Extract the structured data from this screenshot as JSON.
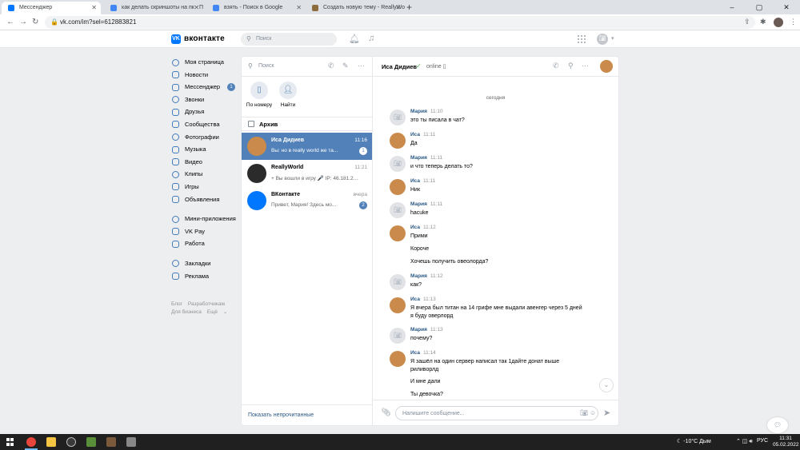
{
  "browser": {
    "tabs": [
      {
        "title": "Мессенджер",
        "active": true,
        "favicon_color": "#0077ff"
      },
      {
        "title": "как делать скриншоты на пк - П",
        "active": false,
        "favicon_color": "#4285f4"
      },
      {
        "title": "взять - Поиск в Google",
        "active": false,
        "favicon_color": "#4285f4"
      },
      {
        "title": "Создать новую тему - ReallyWo",
        "active": false,
        "favicon_color": "#8a6d3b"
      }
    ],
    "url": "vk.com/im?sel=612883821"
  },
  "vk_header": {
    "logo": "VK",
    "brand": "вконтакте",
    "search_placeholder": "Поиск"
  },
  "left_nav": {
    "items": [
      {
        "label": "Моя страница",
        "icon": "user-icon"
      },
      {
        "label": "Новости",
        "icon": "news-icon"
      },
      {
        "label": "Мессенджер",
        "icon": "message-icon",
        "badge": "1"
      },
      {
        "label": "Звонки",
        "icon": "phone-icon"
      },
      {
        "label": "Друзья",
        "icon": "friends-icon"
      },
      {
        "label": "Сообщества",
        "icon": "communities-icon"
      },
      {
        "label": "Фотографии",
        "icon": "photo-icon"
      },
      {
        "label": "Музыка",
        "icon": "music-icon"
      },
      {
        "label": "Видео",
        "icon": "video-icon"
      },
      {
        "label": "Клипы",
        "icon": "clips-icon"
      },
      {
        "label": "Игры",
        "icon": "games-icon"
      },
      {
        "label": "Объявления",
        "icon": "ads-icon"
      }
    ],
    "items2": [
      {
        "label": "Мини-приложения",
        "icon": "apps-icon"
      },
      {
        "label": "VK Pay",
        "icon": "vkpay-icon"
      },
      {
        "label": "Работа",
        "icon": "work-icon"
      }
    ],
    "items3": [
      {
        "label": "Закладки",
        "icon": "bookmark-icon"
      },
      {
        "label": "Реклама",
        "icon": "advertising-icon"
      }
    ],
    "footer": {
      "blog": "Блог",
      "developers": "Разработчикам",
      "business": "Для бизнеса",
      "more": "Ещё"
    }
  },
  "conversations": {
    "search_placeholder": "Поиск",
    "quick_actions": [
      {
        "label": "По номеру"
      },
      {
        "label": "Найти"
      }
    ],
    "archive_label": "Архив",
    "list": [
      {
        "name": "Иса Дидиев",
        "time": "11:16",
        "preview": "Вы: но в really world же та...",
        "badge": "1",
        "active": true,
        "avatar_color": "#c98a4b"
      },
      {
        "name": "ReallyWorld",
        "time": "11:21",
        "preview": "+ Вы вошли в игру 🎤 IP: 46.181.21...",
        "badge": "",
        "active": false,
        "avatar_color": "#2b2b2b"
      },
      {
        "name": "ВКонтакте",
        "time": "вчера",
        "preview": "Привет, Мария! Здесь мо...",
        "badge": "2",
        "active": false,
        "avatar_color": "#0077ff"
      }
    ],
    "footer_link": "Показать непрочитанные"
  },
  "chat": {
    "peer_name": "Иса Дидиев",
    "peer_status": "online",
    "day_label": "сегодня",
    "composer_placeholder": "Напишите сообщение...",
    "messages": [
      {
        "author": "Мария",
        "time": "11:10",
        "lines": [
          "это ты писала в чат?"
        ],
        "avatar": "camera"
      },
      {
        "author": "Иса",
        "time": "11:11",
        "lines": [
          "Да"
        ],
        "avatar": "photo"
      },
      {
        "author": "Мария",
        "time": "11:11",
        "lines": [
          "и что теперь делать то?"
        ],
        "avatar": "camera"
      },
      {
        "author": "Иса",
        "time": "11:11",
        "lines": [
          "Ник"
        ],
        "avatar": "photo"
      },
      {
        "author": "Мария",
        "time": "11:11",
        "lines": [
          "hacuke"
        ],
        "avatar": "camera"
      },
      {
        "author": "Иса",
        "time": "11:12",
        "lines": [
          "Прими",
          "Короче",
          "Хочешь получить овеолорда?"
        ],
        "avatar": "photo"
      },
      {
        "author": "Мария",
        "time": "11:12",
        "lines": [
          "как?"
        ],
        "avatar": "camera"
      },
      {
        "author": "Иса",
        "time": "11:13",
        "lines": [
          "Я вчера был титан на 14 грифе мне выдали авенгер через 5 дней я буду оверлорд"
        ],
        "avatar": "photo"
      },
      {
        "author": "Мария",
        "time": "11:13",
        "lines": [
          "почему?"
        ],
        "avatar": "camera"
      },
      {
        "author": "Иса",
        "time": "11:14",
        "lines": [
          "Я зашёл на один сервер написал так 1дайте донат выше риливорлд",
          "И мне дали",
          "Ты девочка?"
        ],
        "avatar": "photo"
      }
    ]
  },
  "taskbar": {
    "weather": "-10°C  Дым",
    "lang": "РУС",
    "time": "11:31",
    "date": "05.02.2022"
  }
}
